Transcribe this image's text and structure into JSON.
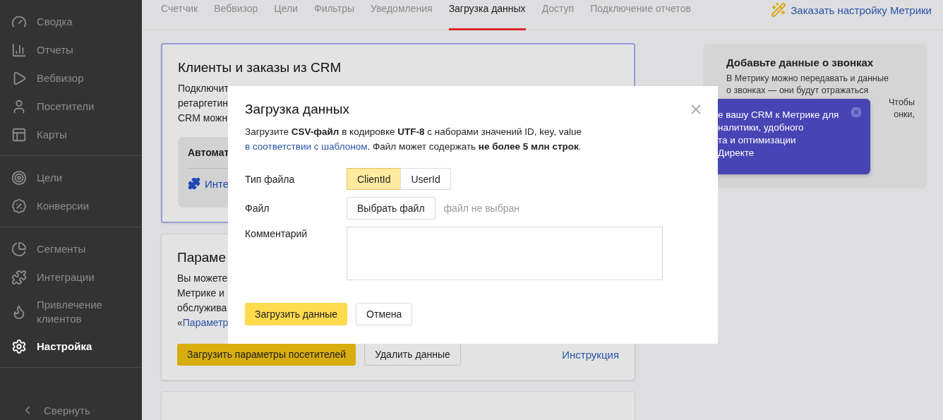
{
  "sidebar": {
    "groups": [
      {
        "items": [
          {
            "label": "Сводка",
            "selected": false
          },
          {
            "label": "Отчеты",
            "selected": false
          },
          {
            "label": "Вебвизор",
            "selected": false
          },
          {
            "label": "Посетители",
            "selected": false
          },
          {
            "label": "Карты",
            "selected": false
          }
        ]
      },
      {
        "items": [
          {
            "label": "Цели",
            "selected": false
          },
          {
            "label": "Конверсии",
            "selected": false
          }
        ]
      },
      {
        "items": [
          {
            "label": "Сегменты",
            "selected": false
          },
          {
            "label": "Интеграции",
            "selected": false
          },
          {
            "label": "Привлечение клиентов",
            "selected": false
          },
          {
            "label": "Настройка",
            "selected": true
          }
        ]
      }
    ],
    "collapse": "Свернуть"
  },
  "tabs": [
    {
      "label": "Счетчик",
      "selected": false
    },
    {
      "label": "Вебвизор",
      "selected": false
    },
    {
      "label": "Цели",
      "selected": false
    },
    {
      "label": "Фильтры",
      "selected": false
    },
    {
      "label": "Уведомления",
      "selected": false
    },
    {
      "label": "Загрузка данных",
      "selected": true
    },
    {
      "label": "Доступ",
      "selected": false
    },
    {
      "label": "Подключение отчетов",
      "selected": false
    }
  ],
  "order_link": "Заказать настройку Метрики",
  "crm_card": {
    "title": "Клиенты и заказы из CRM",
    "lines": [
      "Подключит",
      "ретаргетин",
      "CRM можн"
    ],
    "inner": {
      "title": "Автомат",
      "link": "Инте"
    }
  },
  "params_card": {
    "title": "Параме",
    "lines": [
      "Вы можете",
      "Метрике и",
      "обслужива"
    ],
    "quote": "«",
    "link": "Параметр",
    "buttons": [
      "Загрузить параметры посетителей",
      "Удалить данные"
    ],
    "help_link": "Инструкция"
  },
  "calls_card": {
    "title": "Добавьте данные о звонках",
    "lines": [
      "В Метрику можно передавать и данные",
      "о звонках — они будут отражаться"
    ],
    "tails": [
      "Чтобы",
      "онки,"
    ]
  },
  "popover": {
    "lines": [
      "е вашу CRM к Метрике для",
      "налитики, удобного",
      "та и оптимизации",
      "Директе"
    ]
  },
  "modal": {
    "title": "Загрузка данных",
    "desc_start": "Загрузите **CSV-файл** в кодировке **UTF-8** с наборами значений ID, key, value",
    "desc_link": "в соответствии с шаблоном",
    "desc_end": ". Файл может содержать **не более 5 млн строк**.",
    "file_type": {
      "label": "Тип файла",
      "options": [
        {
          "label": "ClientId",
          "selected": true
        },
        {
          "label": "UserId",
          "selected": false
        }
      ]
    },
    "file": {
      "label": "Файл",
      "button": "Выбрать файл",
      "status": "файл не выбран"
    },
    "comment": {
      "label": "Комментарий"
    },
    "submit": "Загрузить данные",
    "cancel": "Отмена"
  }
}
